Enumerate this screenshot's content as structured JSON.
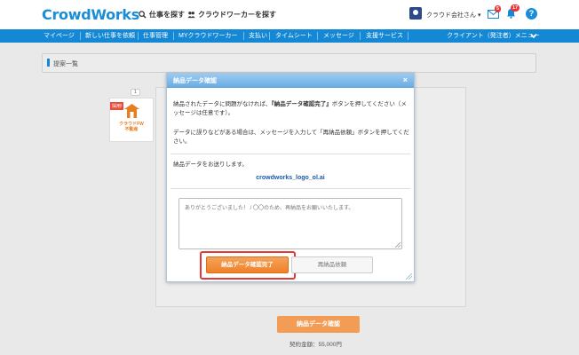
{
  "header": {
    "logo": "CrowdWorks",
    "find_job": "仕事を探す",
    "find_worker": "クラウドワーカーを探す",
    "client_name": "クラウド会社さん ▾",
    "message_count": "5",
    "notification_count": "17",
    "help": "?"
  },
  "nav": {
    "items": [
      "マイページ",
      "新しい仕事を依頼",
      "仕事管理",
      "MYクラウドワーカー",
      "支払い",
      "タイムシート",
      "メッセージ",
      "支援サービス"
    ],
    "client_menu": "クライアント（発注者）メニュー"
  },
  "page": {
    "breadcrumb": "提案一覧",
    "proposal_count": "1",
    "adopted_tag": "採用!",
    "proposal_name_line1": "クラウドFW",
    "proposal_name_line2": "不動産",
    "bg_delivery_button": "納品データ確認",
    "contract_amount": "契約金額：55,000円"
  },
  "modal": {
    "title": "納品データ確認",
    "close": "×",
    "text1_pre": "納品されたデータに問題がなければ、",
    "text1_bold": "『納品データ確認完了』",
    "text1_post": "ボタンを押してください（メッセージは任意です）。",
    "text2": "データに誤りなどがある場合は、メッセージを入力して「再納品依頼」ボタンを押してください。",
    "text3": "納品データをお送りします。",
    "file_name": "crowdworks_logo_ol.ai",
    "message_placeholder": "ありがとうございました！ / 〇〇のため、再納品をお願いいたします。",
    "confirm_button": "納品データ確認完了",
    "redelivery_button": "再納品依頼"
  },
  "colors": {
    "brand_blue": "#1588d5",
    "confirm_orange": "#ef8227",
    "highlight_red": "#e53935"
  }
}
